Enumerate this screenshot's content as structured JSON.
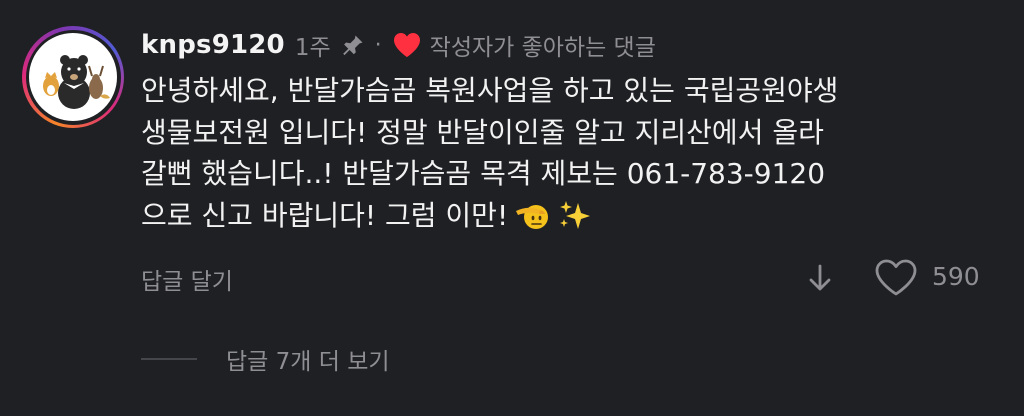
{
  "comment": {
    "username": "knps9120",
    "time_ago": "1주",
    "separator": "·",
    "liked_by_creator": "작성자가 좋아하는 댓글",
    "text_lines": [
      "안녕하세요, 반달가슴곰 복원사업을 하고 있는 국립공원야생",
      "생물보전원 입니다! 정말 반달이인줄 알고 지리산에서 올라",
      "갈뻔 했습니다..! 반달가슴곰 목격 제보는 061-783-9120",
      "으로 신고 바랍니다! 그럼 이만!"
    ],
    "reply_label": "답글 달기",
    "like_count": "590",
    "view_replies_label": "답글 7개 더 보기"
  },
  "icons": {
    "pin": "pin-icon",
    "liked": "heart-filled-icon",
    "dislike": "arrow-down-icon",
    "like": "heart-outline-icon",
    "emoji_1": "saluting-face-emoji",
    "emoji_2": "sparkles-emoji"
  },
  "colors": {
    "background": "#1f2024",
    "text_primary": "#f2f2f2",
    "text_secondary": "#8e8e93",
    "heart_red": "#ff3040"
  }
}
